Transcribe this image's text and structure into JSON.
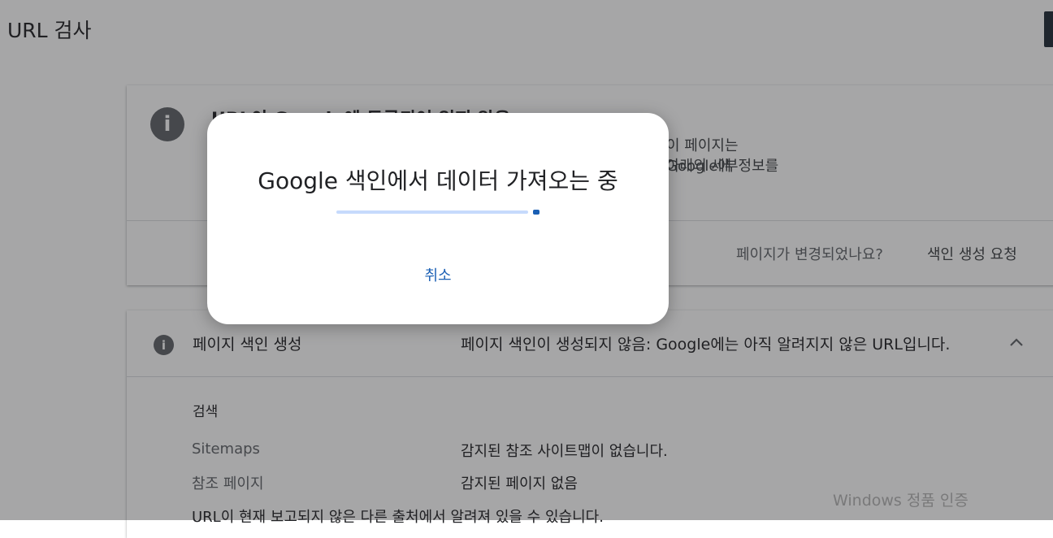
{
  "page": {
    "title": "URL 검사"
  },
  "status_card": {
    "title": "URL이 Google에 등록되어 있지 않음",
    "description_line1": "이 페이지는 Google에",
    "description_line2": "아래의 세부정보를",
    "changed_question": "페이지가 변경되었나요?",
    "request_button": "색인 생성 요청"
  },
  "indexing_card": {
    "section_label": "페이지 색인 생성",
    "section_summary": "페이지 색인이 생성되지 않음: Google에는 아직 알려지지 않은 URL입니다.",
    "group_label": "검색",
    "rows": [
      {
        "label": "Sitemaps",
        "value": "감지된 참조 사이트맵이 없습니다."
      },
      {
        "label": "참조 페이지",
        "value": "감지된 페이지 없음"
      }
    ],
    "note": "URL이 현재 보고되지 않은 다른 출처에서 알려져 있을 수 있습니다."
  },
  "watermark": "Windows 정품 인증",
  "dialog": {
    "title": "Google 색인에서 데이터 가져오는 중",
    "cancel_label": "취소"
  },
  "icons": {
    "info": "info-icon",
    "chevron": "chevron-up-icon"
  },
  "colors": {
    "accent": "#1a5fb4",
    "progress_track": "#c6dafc",
    "scrim": "rgba(32,33,36,0.40)"
  }
}
